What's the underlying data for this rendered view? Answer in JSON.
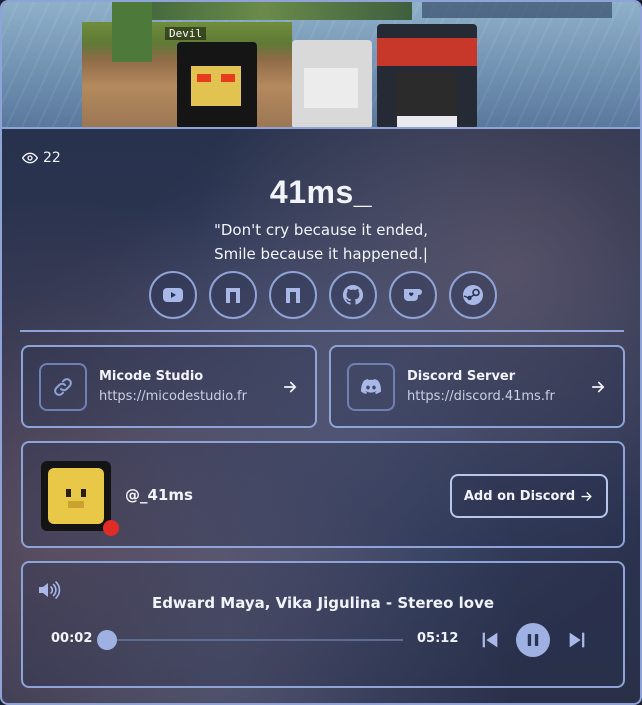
{
  "banner": {
    "tag_text": "Devil"
  },
  "stats": {
    "views": "22"
  },
  "profile": {
    "name": "41ms_",
    "bio_line1": "\"Don't cry because it ended,",
    "bio_line2": "Smile because it happened.|"
  },
  "socials": [
    {
      "icon": "youtube-icon"
    },
    {
      "icon": "namemc-icon"
    },
    {
      "icon": "namemc-icon"
    },
    {
      "icon": "github-icon"
    },
    {
      "icon": "kofi-icon"
    },
    {
      "icon": "steam-icon"
    }
  ],
  "links": [
    {
      "title": "Micode Studio",
      "url": "https://micodestudio.fr",
      "icon": "link-icon"
    },
    {
      "title": "Discord Server",
      "url": "https://discord.41ms.fr",
      "icon": "discord-icon"
    }
  ],
  "discord_user": {
    "handle": "@_41ms",
    "status_color": "#e02c25",
    "add_label": "Add on Discord"
  },
  "player": {
    "track": "Edward Maya, Vika Jigulina - Stereo love",
    "current_time": "00:02",
    "duration": "05:12",
    "progress": 0.0064,
    "state": "playing"
  },
  "colors": {
    "accent": "#8fa3d6",
    "button": "#9fb1e3",
    "status": "#e02c25"
  }
}
